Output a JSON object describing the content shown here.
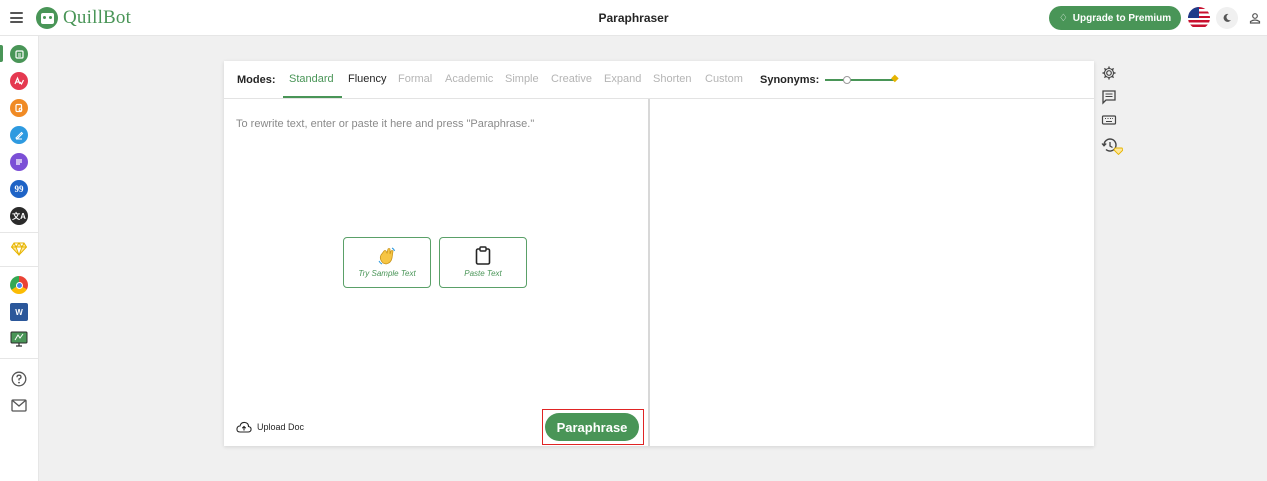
{
  "header": {
    "logo_text": "QuillBot",
    "title": "Paraphraser",
    "upgrade_label": "Upgrade to Premium"
  },
  "sidebar": {
    "items": [
      {
        "name": "paraphraser",
        "color": "#499557",
        "active": true
      },
      {
        "name": "grammar-checker",
        "color": "#e53950"
      },
      {
        "name": "plagiarism-checker",
        "color": "#f08a24"
      },
      {
        "name": "co-writer",
        "color": "#2e9ae0"
      },
      {
        "name": "summarizer",
        "color": "#7b4fd6"
      },
      {
        "name": "citation-generator",
        "color": "#1e63c6"
      },
      {
        "name": "translator",
        "color": "#2b2b2b"
      },
      {
        "name": "premium",
        "color": "#e6b400"
      },
      {
        "name": "chrome-extension",
        "color": "#4285f4"
      },
      {
        "name": "word-addin",
        "color": "#2b579a"
      },
      {
        "name": "desktop-app",
        "color": "#499557"
      },
      {
        "name": "help",
        "color": "#555555"
      },
      {
        "name": "contact",
        "color": "#555555"
      }
    ]
  },
  "editor": {
    "modes_label": "Modes:",
    "modes": [
      "Standard",
      "Fluency",
      "Formal",
      "Academic",
      "Simple",
      "Creative",
      "Expand",
      "Shorten",
      "Custom"
    ],
    "active_mode": "Standard",
    "synonyms_label": "Synonyms:",
    "synonyms_level": 0.25,
    "input_placeholder": "To rewrite text, enter or paste it here and press \"Paraphrase.\"",
    "try_sample_label": "Try Sample Text",
    "paste_text_label": "Paste Text",
    "upload_label": "Upload Doc",
    "paraphrase_label": "Paraphrase"
  },
  "colors": {
    "brand": "#499557",
    "premium": "#e6b400",
    "highlight_outline": "#e02424"
  }
}
